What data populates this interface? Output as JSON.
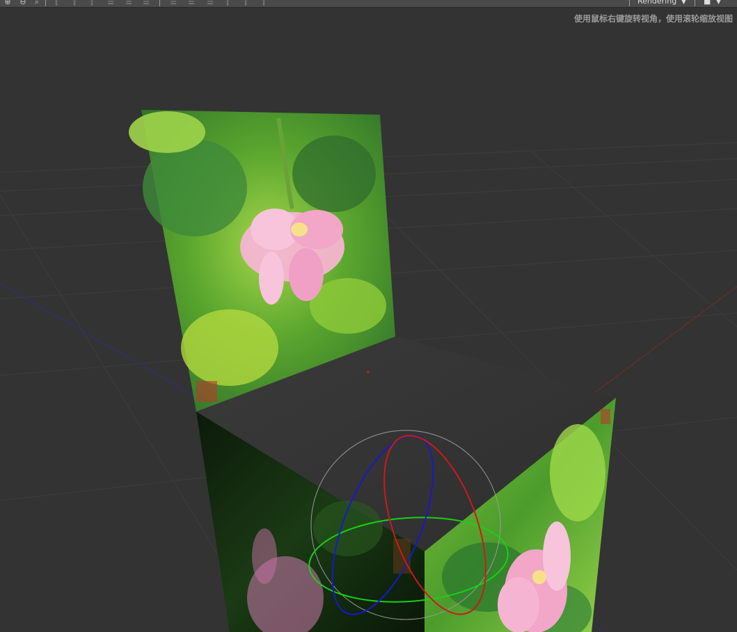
{
  "toolbar": {
    "buttons": [
      {
        "name": "zoom-in-icon",
        "glyph": "⊕"
      },
      {
        "name": "zoom-out-icon",
        "glyph": "⊖"
      },
      {
        "name": "zoom-fit-icon",
        "glyph": "⌕"
      },
      {
        "name": "align-left-icon",
        "glyph": "⫿"
      },
      {
        "name": "align-center-h-icon",
        "glyph": "⫿"
      },
      {
        "name": "align-right-icon",
        "glyph": "⫿"
      },
      {
        "name": "align-top-icon",
        "glyph": "☰"
      },
      {
        "name": "align-middle-v-icon",
        "glyph": "☰"
      },
      {
        "name": "align-bottom-icon",
        "glyph": "☰"
      },
      {
        "name": "distribute-top-icon",
        "glyph": "☰"
      },
      {
        "name": "distribute-middle-icon",
        "glyph": "☰"
      },
      {
        "name": "distribute-bottom-icon",
        "glyph": "☰"
      },
      {
        "name": "distribute-left-icon",
        "glyph": "⫿"
      },
      {
        "name": "distribute-center-icon",
        "glyph": "⫿"
      },
      {
        "name": "distribute-right-icon",
        "glyph": "⫿"
      }
    ],
    "mode_select": {
      "value": "Rendering",
      "chevron": "▼"
    },
    "camera": {
      "icon": "camera-icon",
      "glyph": "■",
      "chevron": "▼"
    }
  },
  "viewport": {
    "hint": "使用鼠标右键旋转视角，使用滚轮缩放视图",
    "colors": {
      "background": "#333333",
      "grid": "#3d3d3d",
      "x_axis": "#7a2a2a",
      "z_axis": "#2e2e8a",
      "gizmo_x": "#d01818",
      "gizmo_y": "#18d018",
      "gizmo_z": "#1818d0",
      "gizmo_outer": "#9a9a9a",
      "leaf": "#3f9a2a",
      "leaf_light": "#8fd33a",
      "lotus": "#f2a6c8"
    }
  }
}
